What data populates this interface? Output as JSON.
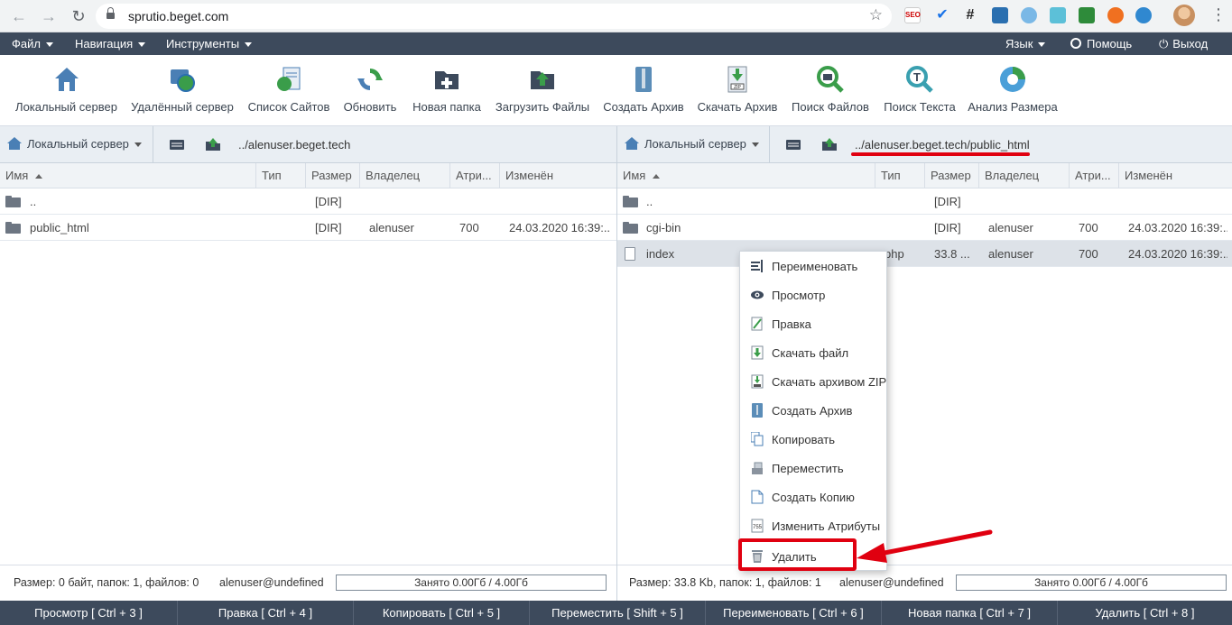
{
  "browser": {
    "url": "sprutio.beget.com"
  },
  "menubar": {
    "file": "Файл",
    "navigation": "Навигация",
    "tools": "Инструменты",
    "language": "Язык",
    "help": "Помощь",
    "logout": "Выход"
  },
  "toolbar": {
    "items": [
      {
        "label": "Локальный сервер",
        "icon": "house-icon"
      },
      {
        "label": "Удалённый сервер",
        "icon": "remote-server-icon"
      },
      {
        "label": "Список Сайтов",
        "icon": "site-list-icon"
      },
      {
        "label": "Обновить",
        "icon": "refresh-icon"
      },
      {
        "label": "Новая папка",
        "icon": "new-folder-icon"
      },
      {
        "label": "Загрузить Файлы",
        "icon": "upload-icon"
      },
      {
        "label": "Создать Архив",
        "icon": "archive-icon"
      },
      {
        "label": "Скачать Архив",
        "icon": "download-zip-icon"
      },
      {
        "label": "Поиск Файлов",
        "icon": "search-files-icon"
      },
      {
        "label": "Поиск Текста",
        "icon": "search-text-icon"
      },
      {
        "label": "Анализ Размера",
        "icon": "size-analysis-icon"
      }
    ]
  },
  "left_panel": {
    "server": "Локальный сервер",
    "path": "../alenuser.beget.tech",
    "columns": [
      "Имя",
      "Тип",
      "Размер",
      "Владелец",
      "Атри...",
      "Изменён"
    ],
    "rows": [
      {
        "name": "..",
        "type": "",
        "size": "[DIR]",
        "owner": "",
        "attrs": "",
        "modified": ""
      },
      {
        "name": "public_html",
        "type": "",
        "size": "[DIR]",
        "owner": "alenuser",
        "attrs": "700",
        "modified": "24.03.2020 16:39:..."
      }
    ],
    "status": "Размер: 0 байт, папок: 1, файлов: 0",
    "user": "alenuser@undefined",
    "quota": "Занято 0.00Гб / 4.00Гб"
  },
  "right_panel": {
    "server": "Локальный сервер",
    "path": "../alenuser.beget.tech/public_html",
    "columns": [
      "Имя",
      "Тип",
      "Размер",
      "Владелец",
      "Атри...",
      "Изменён"
    ],
    "rows": [
      {
        "name": "..",
        "type": "",
        "size": "[DIR]",
        "owner": "",
        "attrs": "",
        "modified": ""
      },
      {
        "name": "cgi-bin",
        "type": "",
        "size": "[DIR]",
        "owner": "alenuser",
        "attrs": "700",
        "modified": "24.03.2020 16:39:..."
      },
      {
        "name": "index",
        "type": "php",
        "size": "33.8 ...",
        "owner": "alenuser",
        "attrs": "700",
        "modified": "24.03.2020 16:39:..."
      }
    ],
    "status": "Размер: 33.8 Kb, папок: 1, файлов: 1",
    "user": "alenuser@undefined",
    "quota": "Занято 0.00Гб / 4.00Гб"
  },
  "context_menu": {
    "items": [
      {
        "label": "Переименовать",
        "icon": "rename-icon"
      },
      {
        "label": "Просмотр",
        "icon": "eye-icon"
      },
      {
        "label": "Правка",
        "icon": "edit-icon"
      },
      {
        "label": "Скачать файл",
        "icon": "download-file-icon"
      },
      {
        "label": "Скачать архивом ZIP",
        "icon": "zip-icon"
      },
      {
        "label": "Создать Архив",
        "icon": "archive-icon"
      },
      {
        "label": "Копировать",
        "icon": "copy-icon"
      },
      {
        "label": "Переместить",
        "icon": "move-icon"
      },
      {
        "label": "Создать Копию",
        "icon": "duplicate-icon"
      },
      {
        "label": "Изменить Атрибуты",
        "icon": "attributes-icon"
      },
      {
        "label": "Удалить",
        "icon": "trash-icon"
      }
    ]
  },
  "function_keys": [
    "Просмотр [ Ctrl + 3 ]",
    "Правка [ Ctrl + 4 ]",
    "Копировать [ Ctrl + 5 ]",
    "Переместить [ Shift + 5 ]",
    "Переименовать [ Ctrl + 6 ]",
    "Новая папка [ Ctrl + 7 ]",
    "Удалить [ Ctrl + 8 ]"
  ],
  "colors": {
    "menubar": "#3d4a5c",
    "highlight": "#e00010"
  }
}
